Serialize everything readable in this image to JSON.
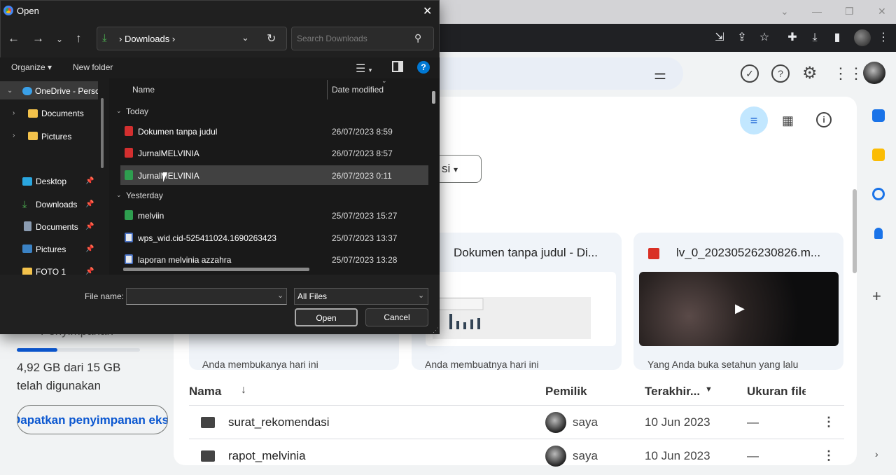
{
  "browser": {
    "colors": {
      "toolbar": "#202124",
      "accent": "#0b57d0"
    }
  },
  "drive": {
    "chip_label": "si",
    "storage": {
      "ghost_label": "Penyimpanan",
      "usage": "4,92 GB dari 15 GB",
      "used_label": "telah digunakan",
      "button_label": "Dapatkan penyimpanan ekstra",
      "fraction_used": 0.33
    },
    "cards": [
      {
        "title": "",
        "subtitle": "Anda membukanya hari ini"
      },
      {
        "title": "Dokumen tanpa judul - Di...",
        "subtitle": "Anda membuatnya hari ini"
      },
      {
        "title": "lv_0_20230526230826.m...",
        "subtitle": "Yang Anda buka setahun yang lalu"
      }
    ],
    "table": {
      "headers": {
        "name": "Nama",
        "owner": "Pemilik",
        "modified": "Terakhir...",
        "size": "Ukuran file"
      },
      "rows": [
        {
          "name": "surat_rekomendasi",
          "owner": "saya",
          "date": "10 Jun 2023",
          "size": "—"
        },
        {
          "name": "rapot_melvinia",
          "owner": "saya",
          "date": "10 Jun 2023",
          "size": "—"
        }
      ]
    }
  },
  "dialog": {
    "title": "Open",
    "address": "Downloads",
    "search_placeholder": "Search Downloads",
    "commands": {
      "organize": "Organize ▾",
      "new_folder": "New folder"
    },
    "nav": [
      {
        "label": "OneDrive - Personal",
        "icon": "cloud-icon"
      },
      {
        "label": "Documents",
        "icon": "folder-icon"
      },
      {
        "label": "Pictures",
        "icon": "folder-icon"
      },
      {
        "label": "Desktop",
        "icon": "desktop-icon"
      },
      {
        "label": "Downloads",
        "icon": "download-icon"
      },
      {
        "label": "Documents",
        "icon": "documents-icon"
      },
      {
        "label": "Pictures",
        "icon": "pictures-icon"
      },
      {
        "label": "FOTO 1",
        "icon": "folder-icon"
      }
    ],
    "columns": {
      "name": "Name",
      "date": "Date modified"
    },
    "groups": {
      "today": "Today",
      "yesterday": "Yesterday"
    },
    "files": [
      {
        "name": "Dokumen tanpa judul",
        "date": "26/07/2023 8:59",
        "type": "pdf"
      },
      {
        "name": "JurnalMELVINIA",
        "date": "26/07/2023 8:57",
        "type": "pdf"
      },
      {
        "name": "JurnalMELVINIA",
        "date": "26/07/2023 0:11",
        "type": "sheet"
      },
      {
        "name": "melviin",
        "date": "25/07/2023 15:27",
        "type": "sheet"
      },
      {
        "name": "wps_wid.cid-525411024.1690263423",
        "date": "25/07/2023 13:37",
        "type": "doc"
      },
      {
        "name": "laporan melvinia azzahra",
        "date": "25/07/2023 13:28",
        "type": "doc"
      }
    ],
    "footer": {
      "file_name_label": "File name:",
      "file_name_value": "",
      "file_type": "All Files",
      "open": "Open",
      "cancel": "Cancel"
    }
  }
}
